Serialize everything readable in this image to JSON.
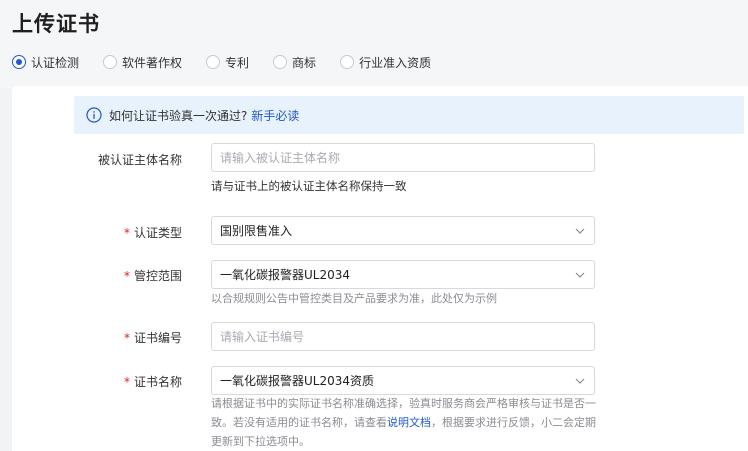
{
  "page": {
    "title": "上传证书"
  },
  "tabs": [
    {
      "label": "认证检测",
      "checked": true
    },
    {
      "label": "软件著作权",
      "checked": false
    },
    {
      "label": "专利",
      "checked": false
    },
    {
      "label": "商标",
      "checked": false
    },
    {
      "label": "行业准入资质",
      "checked": false
    }
  ],
  "notice": {
    "text": "如何让证书验真一次通过?",
    "link": "新手必读"
  },
  "form": {
    "subject_name": {
      "label": "被认证主体名称",
      "placeholder": "请输入被认证主体名称",
      "hint": "请与证书上的被认证主体名称保持一致"
    },
    "cert_type": {
      "required_mark": "*",
      "label": "认证类型",
      "value": "国别限售准入"
    },
    "control_scope": {
      "required_mark": "*",
      "label": "管控范围",
      "value": "一氧化碳报警器UL2034",
      "hint": "以合规规则公告中管控类目及产品要求为准，此处仅为示例"
    },
    "cert_number": {
      "required_mark": "*",
      "label": "证书编号",
      "placeholder": "请输入证书编号"
    },
    "cert_name": {
      "required_mark": "*",
      "label": "证书名称",
      "value": "一氧化碳报警器UL2034资质",
      "hint_line1": "请根据证书中的实际证书名称准确选择，验真时服务商会严格审核与证书是否一",
      "hint_line2_a": "致。若没有适用的证书名称，请查看",
      "hint_link": "说明文档",
      "hint_line2_b": "，根据要求进行反馈，小二会定期",
      "hint_line3": "更新到下拉选项中。"
    }
  },
  "colors": {
    "accent": "#1d57d8",
    "required": "#e02020",
    "notice_bg": "#e8f2fd"
  }
}
